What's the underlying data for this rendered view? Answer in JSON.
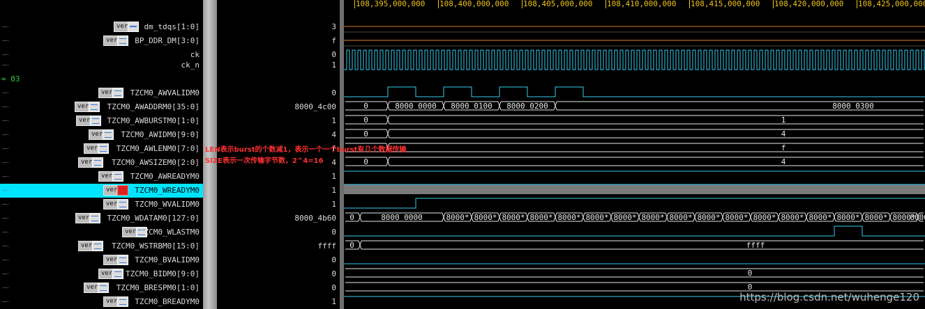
{
  "ruler": {
    "ticks": [
      "108,395,000,000",
      "108,400,000,000",
      "108,405,000,000",
      "108,410,000,000",
      "108,415,000,000",
      "108,420,000,000",
      "108,425,000,000"
    ]
  },
  "group_label": "03",
  "signals": [
    {
      "name": "dm_tdqs[1:0]",
      "value": "3",
      "badge": "ver",
      "icon": "signal-icon"
    },
    {
      "name": "BP_DDR_DM[3:0]",
      "value": "f",
      "badge": "ver",
      "icon": "bus-icon"
    },
    {
      "name": "ck",
      "value": "0",
      "badge": "",
      "icon": ""
    },
    {
      "name": "ck_n",
      "value": "1",
      "badge": "",
      "icon": ""
    },
    {
      "name": "TZCM0_AWVALIDM0",
      "value": "0",
      "badge": "ver",
      "icon": "bus-icon"
    },
    {
      "name": "TZCM0_AWADDRM0[35:0]",
      "value": "8000_4c00",
      "badge": "ver",
      "icon": "bus-icon"
    },
    {
      "name": "TZCM0_AWBURSTM0[1:0]",
      "value": "1",
      "badge": "ver",
      "icon": "bus-icon"
    },
    {
      "name": "TZCM0_AWIDM0[9:0]",
      "value": "4",
      "badge": "ver",
      "icon": "bus-icon"
    },
    {
      "name": "TZCM0_AWLENM0[7:0]",
      "value": "f",
      "badge": "ver",
      "icon": "bus-icon"
    },
    {
      "name": "TZCM0_AWSIZEM0[2:0]",
      "value": "4",
      "badge": "ver",
      "icon": "bus-icon"
    },
    {
      "name": "TZCM0_AWREADYM0",
      "value": "1",
      "badge": "ver",
      "icon": "bus-icon"
    },
    {
      "name": "TZCM0_WREADYM0",
      "value": "1",
      "badge": "ver",
      "icon": "red-icon"
    },
    {
      "name": "TZCM0_WVALIDM0",
      "value": "1",
      "badge": "ver",
      "icon": "bus-icon"
    },
    {
      "name": "TZCM0_WDATAM0[127:0]",
      "value": "8000_4b60",
      "badge": "ver",
      "icon": "bus-icon"
    },
    {
      "name": "TZCM0_WLASTM0",
      "value": "0",
      "badge": "ver",
      "icon": "bus-icon"
    },
    {
      "name": "TZCM0_WSTRBM0[15:0]",
      "value": "ffff",
      "badge": "ver",
      "icon": "bus-icon"
    },
    {
      "name": "TZCM0_BVALIDM0",
      "value": "0",
      "badge": "ver",
      "icon": "bus-icon"
    },
    {
      "name": "TZCM0_BIDM0[9:0]",
      "value": "0",
      "badge": "ver",
      "icon": "bus-icon"
    },
    {
      "name": "TZCM0_BRESPM0[1:0]",
      "value": "0",
      "badge": "ver",
      "icon": "bus-icon"
    },
    {
      "name": "TZCM0_BREADYM0",
      "value": "1",
      "badge": "ver",
      "icon": "bus-icon"
    }
  ],
  "wave_labels": {
    "awaddr": [
      "0",
      "8000_0000",
      "8000_0100",
      "8000_0200",
      "8000_0300"
    ],
    "awburst": [
      "0",
      "1"
    ],
    "awid": [
      "0",
      "4"
    ],
    "awlen": [
      "f"
    ],
    "awsize": [
      "0",
      "4"
    ],
    "wdata": [
      "0",
      "8000_0000",
      "8000*"
    ],
    "wstrb": [
      "0",
      "ffff"
    ],
    "bid": [
      "0"
    ],
    "bresp": [
      "0"
    ]
  },
  "annotations": {
    "len": "LEN表示burst的个数减1，表示一个一个burst有几个数据传输",
    "size": "SIZE表示一次传输字节数，2^4=16"
  },
  "watermark": "https://blog.csdn.net/wuhenge120",
  "colors": {
    "ruler": "#f0c419",
    "highlight": "#00e5ff",
    "signal_line": "#33ccee",
    "bus_line": "#e8e8e8",
    "orange": "#e07a20",
    "clock": "#33ccee",
    "green": "#2ecc40"
  }
}
